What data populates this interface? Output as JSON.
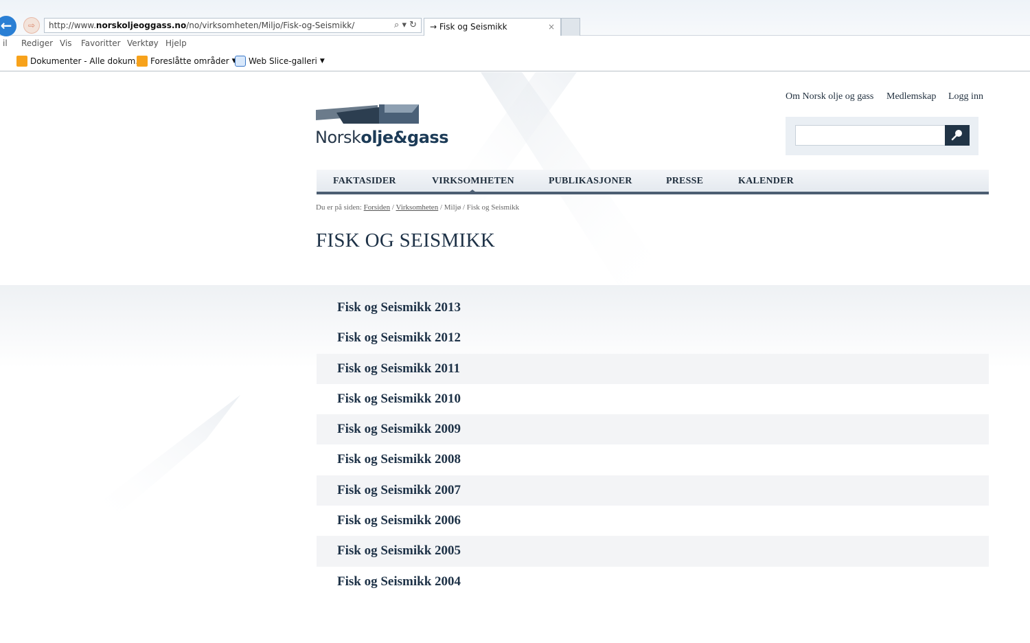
{
  "browser": {
    "url_prefix": "http://www.",
    "url_domain": "norskoljeoggass.no",
    "url_path": "/no/virksomheten/Miljo/Fisk-og-Seismikk/",
    "addr_tools": "⌕ ▾ ↻",
    "tab_title": "→ Fisk og Seismikk",
    "tab_close": "×",
    "menu": [
      "il",
      "Rediger",
      "Vis",
      "Favoritter",
      "Verktøy",
      "Hjelp"
    ],
    "favorites": [
      {
        "label": "Dokumenter - Alle dokum...",
        "icon": "sharepoint-icon"
      },
      {
        "label": "Foreslåtte områder",
        "icon": "suggested-sites-icon"
      },
      {
        "label": "Web Slice-galleri",
        "icon": "ie-icon"
      }
    ]
  },
  "header": {
    "logo_regular": "Norsk",
    "logo_bold": "olje&gass",
    "top_links": [
      "Om Norsk olje og gass",
      "Medlemskap",
      "Logg inn"
    ],
    "search_value": ""
  },
  "nav": {
    "items": [
      "FAKTASIDER",
      "VIRKSOMHETEN",
      "PUBLIKASJONER",
      "PRESSE",
      "KALENDER"
    ],
    "active": "VIRKSOMHETEN"
  },
  "breadcrumb": {
    "prefix": "Du er på siden:",
    "links": [
      "Forsiden",
      "Virksomheten"
    ],
    "rest": "/ Miljø / Fisk og Seismikk",
    "sep": "/"
  },
  "page": {
    "title": "FISK OG SEISMIKK"
  },
  "items": [
    "Fisk og Seismikk 2013",
    "Fisk og Seismikk 2012",
    "Fisk og Seismikk 2011",
    "Fisk og Seismikk 2010",
    "Fisk og Seismikk 2009",
    "Fisk og Seismikk 2008",
    "Fisk og Seismikk 2007",
    "Fisk og Seismikk 2006",
    "Fisk og Seismikk 2005",
    "Fisk og Seismikk 2004"
  ],
  "colors": {
    "brand_dark": "#1e3247",
    "nav_border": "#4c5e72",
    "row_shade": "#f3f4f6"
  }
}
